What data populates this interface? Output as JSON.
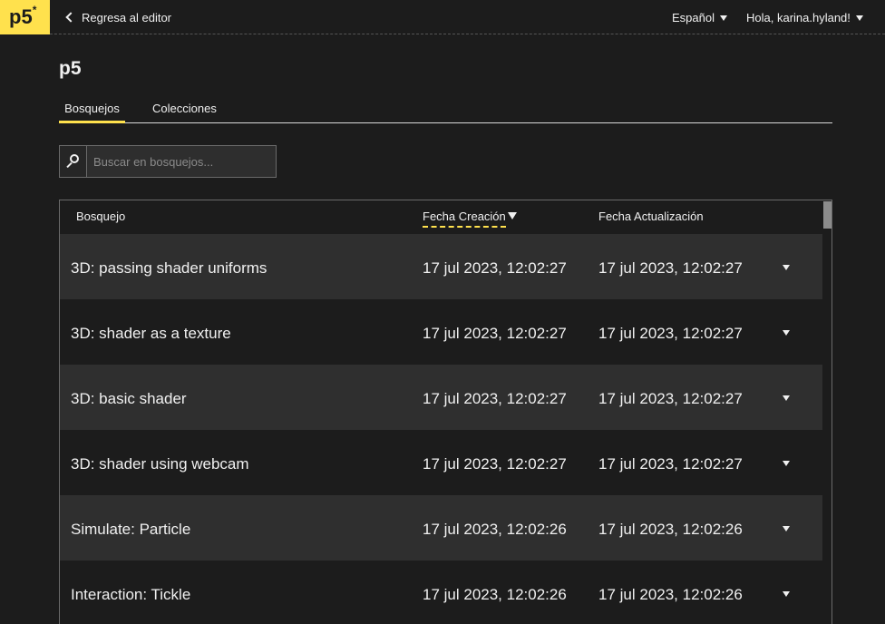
{
  "logo": {
    "text": "p5",
    "mark": "*"
  },
  "nav": {
    "back_label": "Regresa al editor",
    "language": "Español",
    "user_greeting": "Hola, karina.hyland!"
  },
  "page": {
    "title": "p5"
  },
  "tabs": [
    {
      "label": "Bosquejos",
      "active": true
    },
    {
      "label": "Colecciones",
      "active": false
    }
  ],
  "search": {
    "placeholder": "Buscar en bosquejos...",
    "value": ""
  },
  "table": {
    "columns": {
      "name": "Bosquejo",
      "created": "Fecha Creación",
      "updated": "Fecha Actualización"
    },
    "sorted_by": "created",
    "sort_direction": "descending",
    "rows": [
      {
        "name": "3D: passing shader uniforms",
        "created": "17 jul 2023, 12:02:27",
        "updated": "17 jul 2023, 12:02:27"
      },
      {
        "name": "3D: shader as a texture",
        "created": "17 jul 2023, 12:02:27",
        "updated": "17 jul 2023, 12:02:27"
      },
      {
        "name": "3D: basic shader",
        "created": "17 jul 2023, 12:02:27",
        "updated": "17 jul 2023, 12:02:27"
      },
      {
        "name": "3D: shader using webcam",
        "created": "17 jul 2023, 12:02:27",
        "updated": "17 jul 2023, 12:02:27"
      },
      {
        "name": "Simulate: Particle",
        "created": "17 jul 2023, 12:02:26",
        "updated": "17 jul 2023, 12:02:26"
      },
      {
        "name": "Interaction: Tickle",
        "created": "17 jul 2023, 12:02:26",
        "updated": "17 jul 2023, 12:02:26"
      }
    ]
  },
  "icons": {
    "back": "chevron-left-icon",
    "dropdown": "caret-down-icon",
    "search": "search-icon",
    "sort": "sort-descending-icon",
    "row_menu": "row-menu-caret-icon"
  },
  "colors": {
    "accent": "#ffe14d",
    "background": "#1c1c1c",
    "row_alt": "#2f2f2f",
    "text": "#f0f0f0"
  }
}
